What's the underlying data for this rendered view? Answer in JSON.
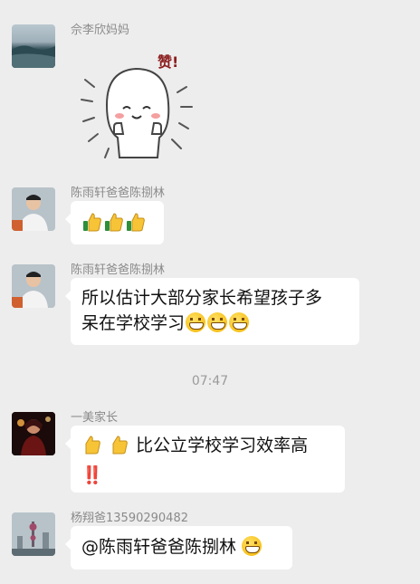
{
  "messages": [
    {
      "sender": "佘李欣妈妈",
      "type": "sticker",
      "sticker_text": "赞!",
      "sticker": "thumbs-up-sticker"
    },
    {
      "sender": "陈雨轩爸爸陈捌林",
      "type": "emoji",
      "emojis": [
        "thumbs-up-icon",
        "thumbs-up-icon",
        "thumbs-up-icon"
      ]
    },
    {
      "sender": "陈雨轩爸爸陈捌林",
      "type": "text",
      "line1": "所以估计大部分家长希望孩子多",
      "line2": "呆在学校学习"
    },
    {
      "sender": "一美家长",
      "type": "text",
      "line1": "比公立学校学习效率高",
      "line2": "‼️"
    },
    {
      "sender": "杨翔爸13590290482",
      "type": "text",
      "text": "@陈雨轩爸爸陈捌林"
    }
  ],
  "timestamp": "07:47",
  "colors": {
    "background": "#ededed",
    "bubble": "#ffffff",
    "sender": "#8a8a8a",
    "exclamation": "#e02020"
  }
}
